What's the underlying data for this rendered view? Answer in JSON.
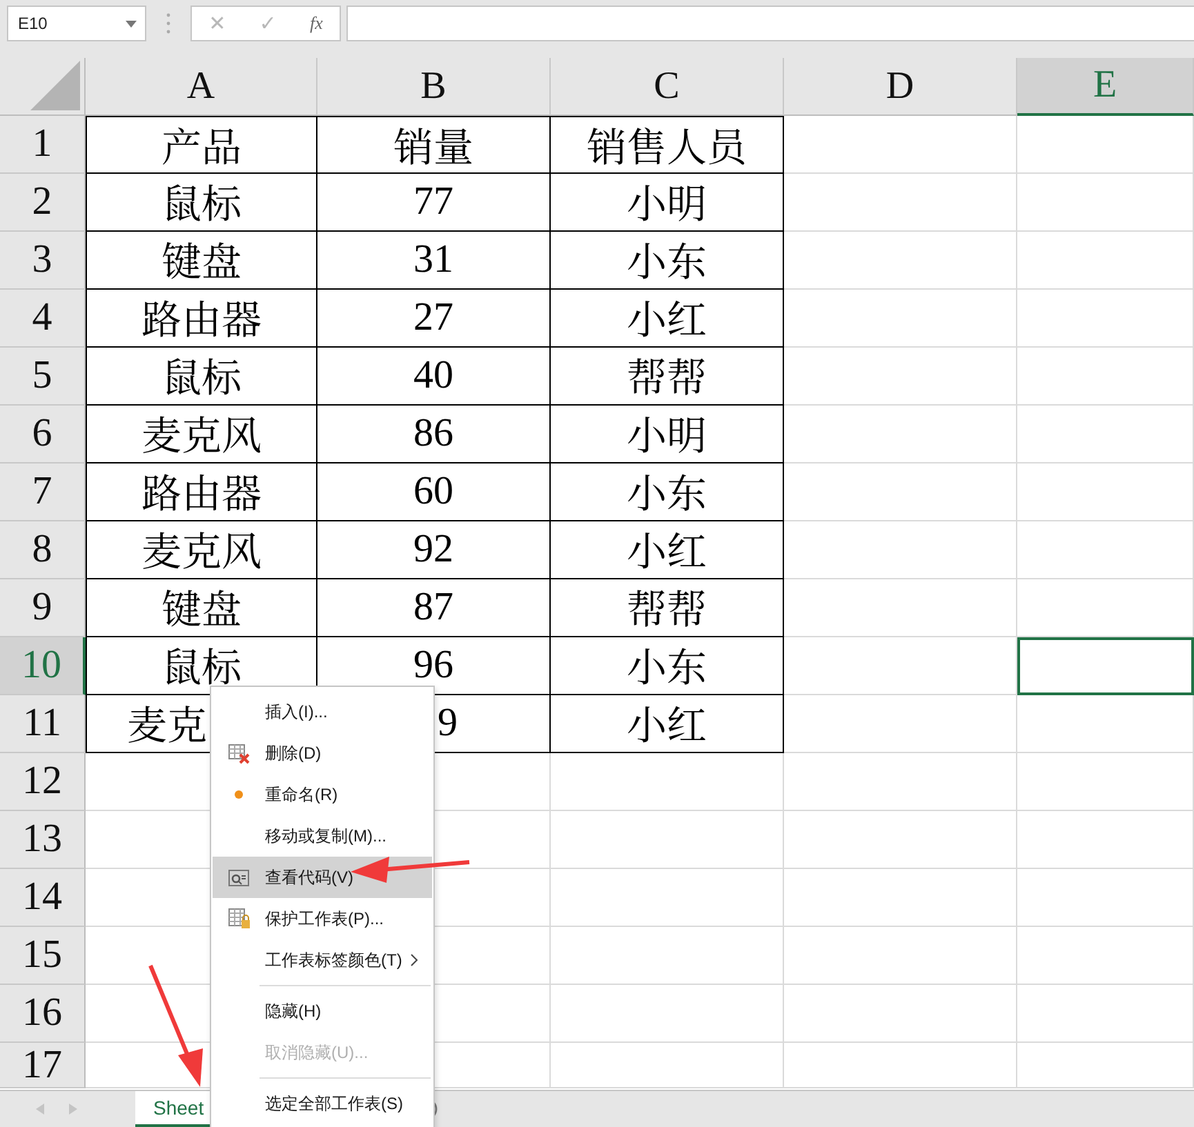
{
  "name_box": {
    "value": "E10"
  },
  "formula_bar": {
    "cancel": "✕",
    "enter": "✓",
    "function": "fx"
  },
  "columns": [
    {
      "label": "A",
      "selected": false
    },
    {
      "label": "B",
      "selected": false
    },
    {
      "label": "C",
      "selected": false
    },
    {
      "label": "D",
      "selected": false
    },
    {
      "label": "E",
      "selected": true
    }
  ],
  "rows": [
    {
      "label": "1",
      "selected": false,
      "cells": [
        "产品",
        "销量",
        "销售人员"
      ]
    },
    {
      "label": "2",
      "selected": false,
      "cells": [
        "鼠标",
        "77",
        "小明"
      ]
    },
    {
      "label": "3",
      "selected": false,
      "cells": [
        "键盘",
        "31",
        "小东"
      ]
    },
    {
      "label": "4",
      "selected": false,
      "cells": [
        "路由器",
        "27",
        "小红"
      ]
    },
    {
      "label": "5",
      "selected": false,
      "cells": [
        "鼠标",
        "40",
        "帮帮"
      ]
    },
    {
      "label": "6",
      "selected": false,
      "cells": [
        "麦克风",
        "86",
        "小明"
      ]
    },
    {
      "label": "7",
      "selected": false,
      "cells": [
        "路由器",
        "60",
        "小东"
      ]
    },
    {
      "label": "8",
      "selected": false,
      "cells": [
        "麦克风",
        "92",
        "小红"
      ]
    },
    {
      "label": "9",
      "selected": false,
      "cells": [
        "键盘",
        "87",
        "帮帮"
      ]
    },
    {
      "label": "10",
      "selected": true,
      "cells": [
        "鼠标",
        "96",
        "小东"
      ]
    },
    {
      "label": "11",
      "selected": false,
      "cells": [
        "麦克",
        "9",
        "小红"
      ]
    },
    {
      "label": "12",
      "selected": false
    },
    {
      "label": "13",
      "selected": false
    },
    {
      "label": "14",
      "selected": false
    },
    {
      "label": "15",
      "selected": false
    },
    {
      "label": "16",
      "selected": false
    },
    {
      "label": "17",
      "selected": false
    }
  ],
  "context_menu": [
    {
      "kind": "item",
      "label": "插入(I)...",
      "selected": false,
      "disabled": false
    },
    {
      "kind": "item",
      "label": "删除(D)",
      "selected": false,
      "disabled": false
    },
    {
      "kind": "item",
      "label": "重命名(R)",
      "selected": false,
      "disabled": false
    },
    {
      "kind": "item",
      "label": "移动或复制(M)...",
      "selected": false,
      "disabled": false
    },
    {
      "kind": "item",
      "label": "查看代码(V)",
      "selected": true,
      "disabled": false
    },
    {
      "kind": "item",
      "label": "保护工作表(P)...",
      "selected": false,
      "disabled": false
    },
    {
      "kind": "submenu",
      "label": "工作表标签颜色(T)",
      "selected": false,
      "disabled": false
    },
    {
      "kind": "separator"
    },
    {
      "kind": "item",
      "label": "隐藏(H)",
      "selected": false,
      "disabled": false
    },
    {
      "kind": "item",
      "label": "取消隐藏(U)...",
      "selected": false,
      "disabled": true
    },
    {
      "kind": "separator"
    },
    {
      "kind": "item",
      "label": "选定全部工作表(S)",
      "selected": false,
      "disabled": false
    }
  ],
  "sheet_tabs": [
    {
      "label": "Sheet",
      "selected": true
    }
  ]
}
